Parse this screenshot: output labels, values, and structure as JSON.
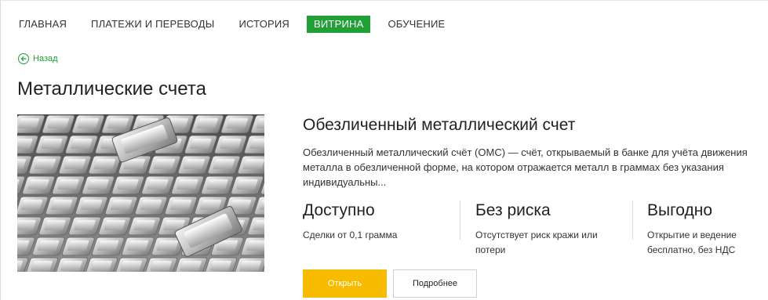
{
  "nav": {
    "items": [
      {
        "label": "ГЛАВНАЯ",
        "active": false
      },
      {
        "label": "ПЛАТЕЖИ И ПЕРЕВОДЫ",
        "active": false
      },
      {
        "label": "ИСТОРИЯ",
        "active": false
      },
      {
        "label": "ВИТРИНА",
        "active": true
      },
      {
        "label": "ОБУЧЕНИЕ",
        "active": false
      }
    ]
  },
  "back": {
    "label": "Назад",
    "icon": "arrow-left-circle-icon"
  },
  "page_title": "Металлические счета",
  "hero": {
    "image": "silver-bars"
  },
  "product": {
    "title": "Обезличенный металлический счет",
    "description": "Обезличенный металлический счёт (ОМС) — счёт, открываемый в банке для учёта движения металла в обезличенной форме, на котором отражается металл в граммах без указания индивидуальны..."
  },
  "features": [
    {
      "title": "Доступно",
      "text": "Сделки от 0,1 грамма"
    },
    {
      "title": "Без риска",
      "text": "Отсутствует риск кражи или потери"
    },
    {
      "title": "Выгодно",
      "text": "Открытие и ведение бесплатно, без НДС"
    }
  ],
  "buttons": {
    "open": "Открыть",
    "more": "Подробнее"
  },
  "colors": {
    "accent": "#21a038",
    "primary_button": "#f7bb00"
  }
}
